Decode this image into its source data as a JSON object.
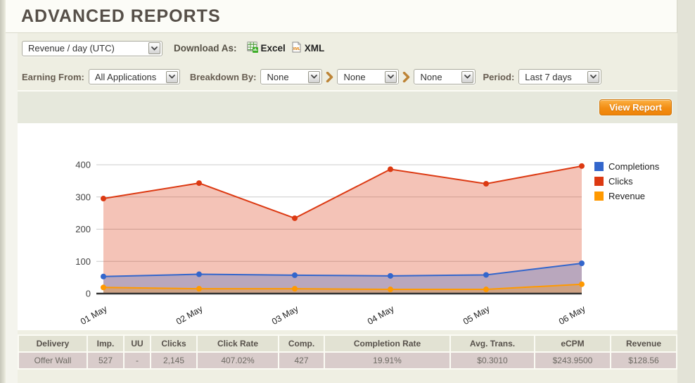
{
  "page_title": "ADVANCED REPORTS",
  "toolbar": {
    "report_type": "Revenue / day (UTC)",
    "download_as_label": "Download As:",
    "excel_label": "Excel",
    "xml_label": "XML"
  },
  "filters": {
    "earning_from_label": "Earning From:",
    "earning_from_value": "All Applications",
    "breakdown_by_label": "Breakdown By:",
    "breakdown_values": [
      "None",
      "None",
      "None"
    ],
    "period_label": "Period:",
    "period_value": "Last 7 days",
    "view_report_label": "View Report"
  },
  "chart_data": {
    "type": "area",
    "categories": [
      "01 May",
      "02 May",
      "03 May",
      "04 May",
      "05 May",
      "06 May"
    ],
    "series": [
      {
        "name": "Clicks",
        "color": "#dc3912",
        "values": [
          295,
          343,
          234,
          386,
          341,
          396
        ]
      },
      {
        "name": "Completions",
        "color": "#3366cc",
        "values": [
          53,
          60,
          57,
          55,
          58,
          94
        ]
      },
      {
        "name": "Revenue",
        "color": "#ff9900",
        "values": [
          19,
          15,
          15,
          13,
          13,
          29
        ]
      }
    ],
    "legend": [
      {
        "label": "Completions",
        "color": "#3366cc"
      },
      {
        "label": "Clicks",
        "color": "#dc3912"
      },
      {
        "label": "Revenue",
        "color": "#ff9900"
      }
    ],
    "title": "",
    "xlabel": "",
    "ylabel": "",
    "ylim": [
      0,
      400
    ],
    "yticks": [
      0,
      100,
      200,
      300,
      400
    ],
    "grid": true,
    "legend_position": "right"
  },
  "table": {
    "headers": [
      "Delivery",
      "Imp.",
      "UU",
      "Clicks",
      "Click Rate",
      "Comp.",
      "Completion Rate",
      "Avg. Trans.",
      "eCPM",
      "Revenue"
    ],
    "rows": [
      [
        "Offer Wall",
        "527",
        "-",
        "2,145",
        "407.02%",
        "427",
        "19.91%",
        "$0.3010",
        "$243.9500",
        "$128.56"
      ]
    ]
  },
  "colors": {
    "accent_button_orange": "#f28d13",
    "title_text": "#564f48",
    "page_background": "#e3e3d7",
    "band_background": "#eeeee2"
  }
}
